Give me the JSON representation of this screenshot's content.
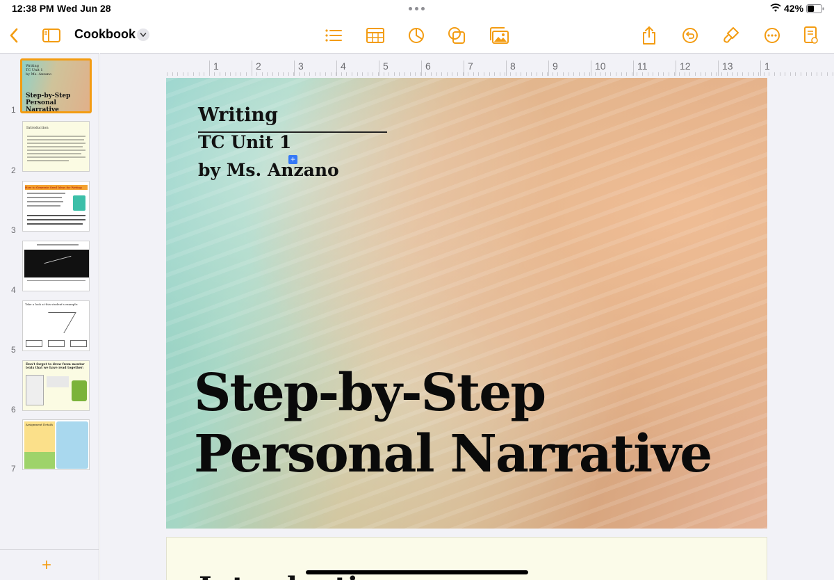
{
  "status": {
    "time": "12:38 PM",
    "date": "Wed Jun 28",
    "battery": "42%"
  },
  "toolbar": {
    "back_icon": "chevron-left-icon",
    "title": "Cookbook",
    "accent": "#f39c12"
  },
  "slides": [
    {
      "number": "1",
      "title_line1": "Writing",
      "title_line2": "TC Unit 1",
      "title_line3": "by Ms. Anzano",
      "caption": "Step-by-Step Personal Narrative"
    },
    {
      "number": "2",
      "caption": "Introduction"
    },
    {
      "number": "3",
      "caption": "How to Generate Seed Ideas for Writing"
    },
    {
      "number": "4"
    },
    {
      "number": "5",
      "caption": "Take a look at this student's example:"
    },
    {
      "number": "6",
      "caption": "Don't forget to draw from mentor texts that we have read together:"
    },
    {
      "number": "7",
      "caption": "Assignment Details"
    }
  ],
  "ruler": [
    "1",
    "2",
    "3",
    "4",
    "5",
    "6",
    "7",
    "8",
    "9",
    "10",
    "11",
    "12",
    "13",
    "1"
  ],
  "page": {
    "writing": "Writing",
    "unit": "TC Unit 1",
    "author": "by Ms. Anzano",
    "title_line1": "Step-by-Step",
    "title_line2": "Personal Narrative",
    "next_heading": "Introduction"
  },
  "sidebar": {
    "add_label": "+"
  }
}
